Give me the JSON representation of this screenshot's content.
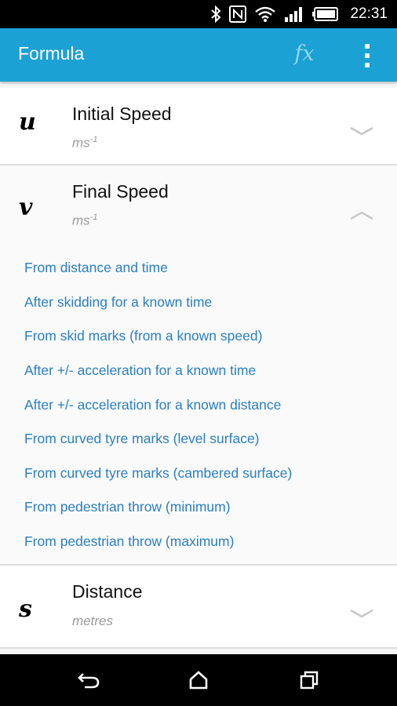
{
  "status_bar": {
    "time": "22:31",
    "icons": [
      "bluetooth-icon",
      "nfc-icon",
      "wifi-icon",
      "signal-icon",
      "battery-icon"
    ]
  },
  "app_bar": {
    "title": "Formula",
    "fx_icon": "fx",
    "menu_icon": "overflow-menu-icon"
  },
  "variables": [
    {
      "symbol": "u",
      "name": "Initial Speed",
      "unit": "ms",
      "unit_exp": "-1",
      "expanded": false
    },
    {
      "symbol": "v",
      "name": "Final Speed",
      "unit": "ms",
      "unit_exp": "-1",
      "expanded": true,
      "formulas": [
        "From distance and time",
        "After skidding for a known time",
        "From skid marks (from a known speed)",
        "After +/- acceleration for a known time",
        "After +/- acceleration for a known distance",
        "From curved tyre marks (level surface)",
        "From curved tyre marks (cambered surface)",
        "From pedestrian throw (minimum)",
        "From pedestrian throw (maximum)"
      ]
    },
    {
      "symbol": "s",
      "name": "Distance",
      "unit": "metres",
      "unit_exp": "",
      "expanded": false
    }
  ],
  "nav_bar": {
    "buttons": [
      "back-icon",
      "home-icon",
      "recent-apps-icon"
    ]
  },
  "colors": {
    "app_bar": "#1ba1d4",
    "link": "#2a7fbf",
    "unit": "#9a9a9a"
  }
}
